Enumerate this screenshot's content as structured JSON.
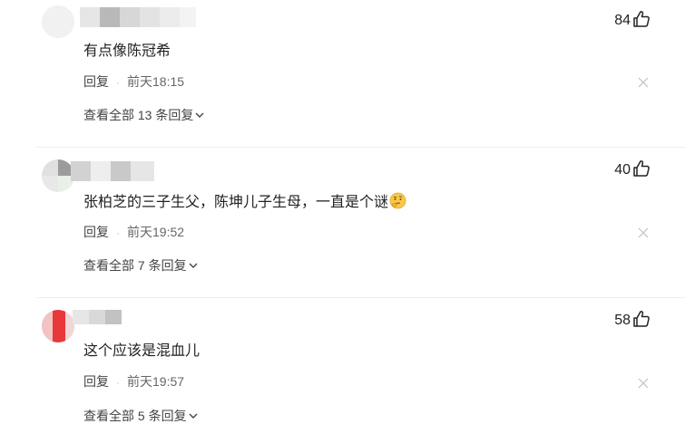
{
  "comments": [
    {
      "text": "有点像陈冠希",
      "reply_label": "回复",
      "separator": "·",
      "time": "前天18:15",
      "view_all": "查看全部 13 条回复",
      "likes": "84"
    },
    {
      "text": "张柏芝的三子生父，陈坤儿子生母，一直是个谜",
      "emoji": "thinking-face-emoji",
      "reply_label": "回复",
      "separator": "·",
      "time": "前天19:52",
      "view_all": "查看全部 7 条回复",
      "likes": "40"
    },
    {
      "text": "这个应该是混血儿",
      "reply_label": "回复",
      "separator": "·",
      "time": "前天19:57",
      "view_all": "查看全部 5 条回复",
      "likes": "58"
    }
  ],
  "icons": {
    "like": "thumbs-up-icon",
    "close": "close-icon",
    "chevron": "chevron-down-icon"
  },
  "colors": {
    "text": "#222222",
    "muted": "#666666",
    "icon": "#c8c8c8",
    "emoji": "#f7c948"
  }
}
